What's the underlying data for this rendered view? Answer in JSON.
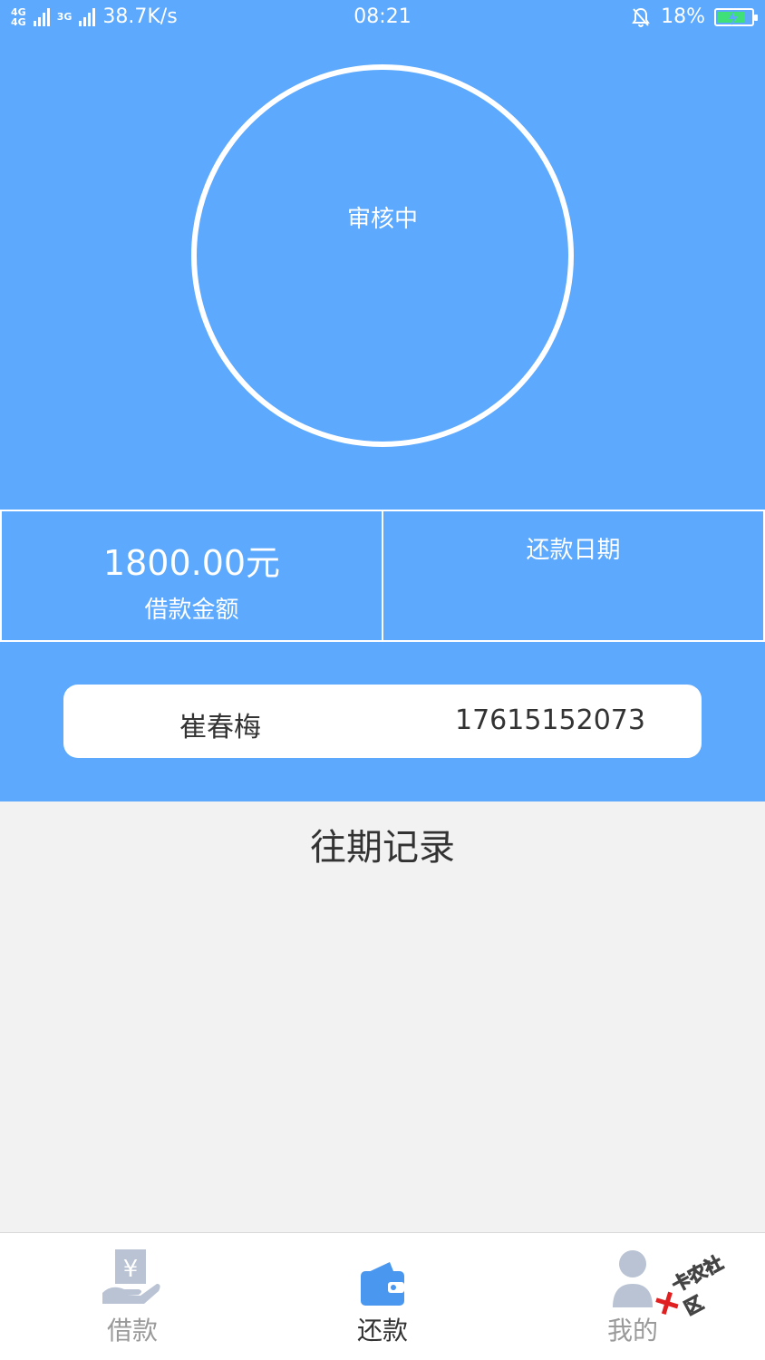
{
  "status_bar": {
    "network_1": "4G",
    "network_2": "4G",
    "network_3": "3G",
    "speed": "38.7K/s",
    "time": "08:21",
    "battery": "18%",
    "icons": [
      "signal-icon",
      "alarm-icon",
      "battery-charging-icon"
    ]
  },
  "review": {
    "status": "审核中"
  },
  "loan_info": {
    "amount": "1800.00元",
    "amount_label": "借款金额",
    "repay_date_label": "还款日期"
  },
  "user": {
    "name": "崔春梅",
    "phone": "17615152073"
  },
  "history": {
    "title": "往期记录"
  },
  "tabs": [
    {
      "label": "借款",
      "icon": "loan-hand-yen-icon",
      "active": false
    },
    {
      "label": "还款",
      "icon": "wallet-icon",
      "active": true
    },
    {
      "label": "我的",
      "icon": "user-icon",
      "active": false
    }
  ],
  "watermark": {
    "text": "卡农社区"
  },
  "colors": {
    "primary": "#5ca9fd",
    "background": "#f2f2f2",
    "tab_active_icon": "#4a97f0",
    "tab_inactive": "#9a9a9a"
  }
}
